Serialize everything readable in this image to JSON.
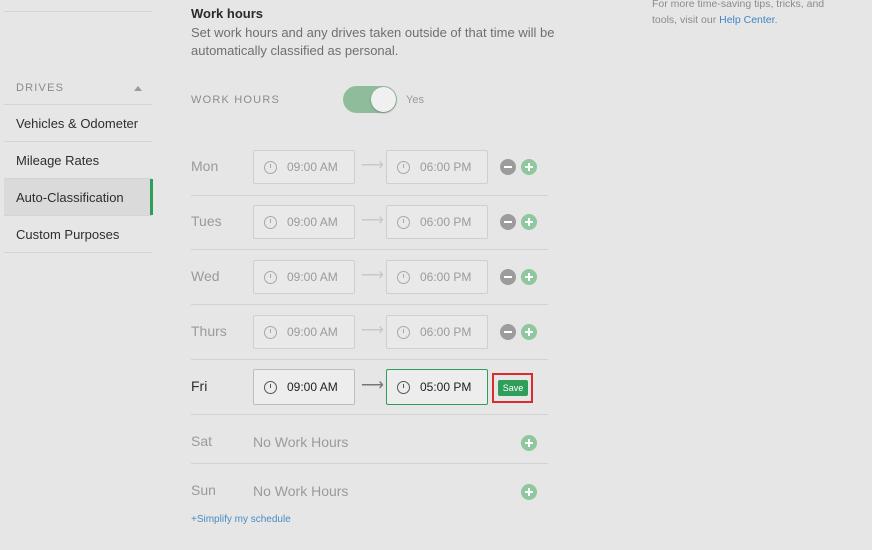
{
  "sidebar": {
    "header": "DRIVES",
    "items": [
      {
        "label": "Vehicles & Odometer"
      },
      {
        "label": "Mileage Rates"
      },
      {
        "label": "Auto-Classification"
      },
      {
        "label": "Custom Purposes"
      }
    ]
  },
  "main": {
    "title": "Work hours",
    "description": "Set work hours and any drives taken outside of that time will be automatically classified as personal.",
    "toggle_label": "WORK HOURS",
    "toggle_state": "Yes",
    "days": [
      {
        "day": "Mon",
        "start": "09:00 AM",
        "end": "06:00 PM"
      },
      {
        "day": "Tues",
        "start": "09:00 AM",
        "end": "06:00 PM"
      },
      {
        "day": "Wed",
        "start": "09:00 AM",
        "end": "06:00 PM"
      },
      {
        "day": "Thurs",
        "start": "09:00 AM",
        "end": "06:00 PM"
      },
      {
        "day": "Fri",
        "start": "09:00 AM",
        "end": "05:00 PM",
        "save": "Save"
      },
      {
        "day": "Sat",
        "status": "No Work Hours"
      },
      {
        "day": "Sun",
        "status": "No Work Hours"
      }
    ],
    "simplify_link": "+Simplify my schedule"
  },
  "tip": {
    "text_before": "For more time-saving tips, tricks, and tools, visit our ",
    "link": "Help Center",
    "text_after": "."
  },
  "colors": {
    "accent_green": "#2f9e5a",
    "highlight_red": "#d92d2d",
    "link_blue": "#3f86c4"
  }
}
